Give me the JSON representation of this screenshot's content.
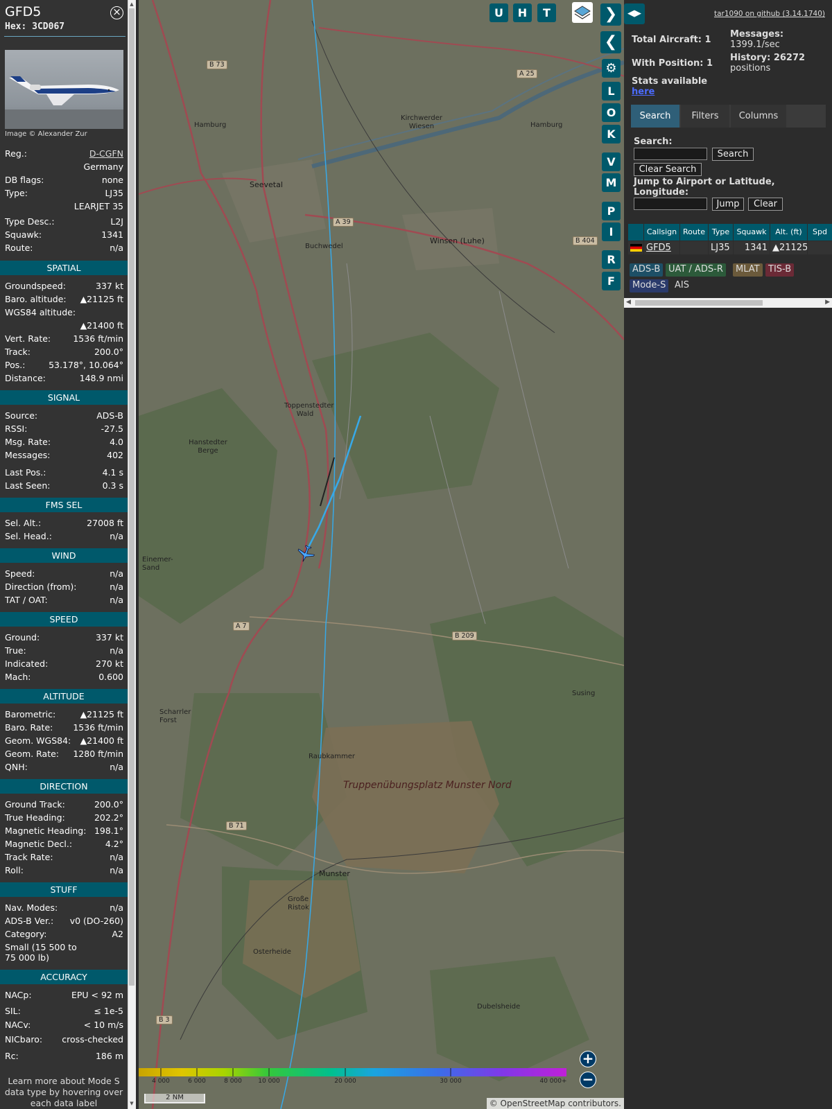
{
  "aircraft": {
    "callsign": "GFD5",
    "hex": "Hex: 3CD067",
    "photo_credit": "Image © Alexander Zur",
    "details": [
      {
        "k": "Reg.:",
        "v": "D-CGFN"
      },
      {
        "k": "",
        "v": "Germany"
      },
      {
        "k": "DB flags:",
        "v": "none"
      },
      {
        "k": "Type:",
        "v": "LJ35"
      },
      {
        "k": "",
        "v": "LEARJET 35"
      },
      {
        "k": "Type Desc.:",
        "v": "L2J"
      },
      {
        "k": "Squawk:",
        "v": "1341"
      },
      {
        "k": "Route:",
        "v": "n/a"
      }
    ],
    "sections": {
      "spatial": {
        "title": "SPATIAL",
        "rows": [
          {
            "k": "Groundspeed:",
            "v": "337 kt"
          },
          {
            "k": "Baro. altitude:",
            "v": "▲21125 ft"
          },
          {
            "k": "WGS84 altitude:",
            "v": ""
          },
          {
            "k": "",
            "v": "▲21400 ft"
          },
          {
            "k": "Vert. Rate:",
            "v": "1536 ft/min"
          },
          {
            "k": "Track:",
            "v": "200.0°"
          },
          {
            "k": "Pos.:",
            "v": "53.178°, 10.064°"
          },
          {
            "k": "Distance:",
            "v": "148.9 nmi"
          }
        ]
      },
      "signal": {
        "title": "SIGNAL",
        "rows": [
          {
            "k": "Source:",
            "v": "ADS-B"
          },
          {
            "k": "RSSI:",
            "v": "-27.5"
          },
          {
            "k": "Msg. Rate:",
            "v": "4.0"
          },
          {
            "k": "Messages:",
            "v": "402"
          },
          {
            "k": "Last Pos.:",
            "v": "4.1 s"
          },
          {
            "k": "Last Seen:",
            "v": "0.3 s"
          }
        ]
      },
      "fms": {
        "title": "FMS SEL",
        "rows": [
          {
            "k": "Sel. Alt.:",
            "v": "27008 ft"
          },
          {
            "k": "Sel. Head.:",
            "v": "n/a"
          }
        ]
      },
      "wind": {
        "title": "WIND",
        "rows": [
          {
            "k": "Speed:",
            "v": "n/a"
          },
          {
            "k": "Direction (from):",
            "v": "n/a"
          },
          {
            "k": "TAT / OAT:",
            "v": "n/a"
          }
        ]
      },
      "speed": {
        "title": "SPEED",
        "rows": [
          {
            "k": "Ground:",
            "v": "337 kt"
          },
          {
            "k": "True:",
            "v": "n/a"
          },
          {
            "k": "Indicated:",
            "v": "270 kt"
          },
          {
            "k": "Mach:",
            "v": "0.600"
          }
        ]
      },
      "altitude": {
        "title": "ALTITUDE",
        "rows": [
          {
            "k": "Barometric:",
            "v": "▲21125 ft"
          },
          {
            "k": "Baro. Rate:",
            "v": "1536 ft/min"
          },
          {
            "k": "Geom. WGS84:",
            "v": "▲21400 ft"
          },
          {
            "k": "Geom. Rate:",
            "v": "1280 ft/min"
          },
          {
            "k": "QNH:",
            "v": "n/a"
          }
        ]
      },
      "direction": {
        "title": "DIRECTION",
        "rows": [
          {
            "k": "Ground Track:",
            "v": "200.0°"
          },
          {
            "k": "True Heading:",
            "v": "202.2°"
          },
          {
            "k": "Magnetic Heading:",
            "v": "198.1°"
          },
          {
            "k": "Magnetic Decl.:",
            "v": "4.2°"
          },
          {
            "k": "Track Rate:",
            "v": "n/a"
          },
          {
            "k": "Roll:",
            "v": "n/a"
          }
        ]
      },
      "stuff": {
        "title": "STUFF",
        "rows": [
          {
            "k": "Nav. Modes:",
            "v": "n/a"
          },
          {
            "k": "ADS-B Ver.:",
            "v": "v0 (DO-260)"
          },
          {
            "k": "Category:",
            "v": "A2"
          }
        ],
        "category_desc": "Small (15 500 to 75 000 lb)"
      },
      "accuracy": {
        "title": "ACCURACY",
        "rows": [
          {
            "k": "NACp:",
            "v": "EPU < 92 m"
          },
          {
            "k": "SIL:",
            "v": "≤ 1e-5"
          },
          {
            "k": "NACv:",
            "v": "< 10 m/s"
          },
          {
            "k": "NICbaro:",
            "v": "cross-checked"
          },
          {
            "k": "Rc:",
            "v": "186 m"
          }
        ]
      }
    },
    "footer_note": "Learn more about Mode S data type by hovering over each data label"
  },
  "map": {
    "buttons_top": [
      "U",
      "H",
      "T"
    ],
    "buttons_side": [
      "L",
      "O",
      "K",
      "V",
      "M",
      "P",
      "I",
      "R",
      "F"
    ],
    "labels": {
      "seevetal": "Seevetal",
      "winsen": "Winsen (Luhe)",
      "buchwedel": "Buchwedel",
      "toppenstedt": "Toppenstedter Wald",
      "hanstedter": "Hanstedter Berge",
      "einemer": "Einemer-Sand",
      "scharrler": "Scharrler Forst",
      "raubkammer": "Raubkammer",
      "truppen": "Truppenübungsplatz Munster Nord",
      "munster": "Munster",
      "grosse_ristok": "Große Ristok",
      "osterheide": "Osterheide",
      "dubelsheide": "Dubelsheide",
      "susing": "Susing",
      "kirchwerder": "Kirchwerder Wiesen",
      "hamburg1": "Hamburg",
      "hamburg2": "Hamburg"
    },
    "shields": [
      "B 73",
      "A 25",
      "A 39",
      "B 404",
      "A 7",
      "B 209",
      "B 71",
      "B 3"
    ],
    "altitude_scale": [
      "4 000",
      "6 000",
      "8 000",
      "10 000",
      "20 000",
      "30 000",
      "40 000+"
    ],
    "scale_bar": "2 NM",
    "attribution": "© OpenStreetMap contributors."
  },
  "sidebar": {
    "github": "tar1090 on github (3.14.1740)",
    "total_aircraft": "Total Aircraft: 1",
    "with_position": "With Position: 1",
    "stats_text": "Stats available",
    "stats_link": "here",
    "messages_label": "Messages:",
    "messages_val": "1399.1/sec",
    "history_label": "History: 26272",
    "history_val": "positions",
    "tabs": [
      "Search",
      "Filters",
      "Columns"
    ],
    "search_label": "Search:",
    "search_btn": "Search",
    "clear_search_btn": "Clear Search",
    "jump_label": "Jump to Airport or Latitude, Longitude:",
    "jump_btn": "Jump",
    "clear_btn": "Clear",
    "table_headers": [
      "",
      "Callsign",
      "Route",
      "Type",
      "Squawk",
      "Alt. (ft)",
      "Spd"
    ],
    "table_row": {
      "callsign": "GFD5",
      "route": "",
      "type": "LJ35",
      "squawk": "1341",
      "alt": "▲21125",
      "spd": ""
    },
    "sources": [
      {
        "label": "ADS-B",
        "bg": "#1d4f66",
        "fg": "#ddd"
      },
      {
        "label": "UAT / ADS-R",
        "bg": "#2c5a3a",
        "fg": "#ddd"
      },
      {
        "label": "MLAT",
        "bg": "#6b5a3b",
        "fg": "#ddd"
      },
      {
        "label": "TIS-B",
        "bg": "#6b2a36",
        "fg": "#ddd"
      },
      {
        "label": "Mode-S",
        "bg": "#2a3a6b",
        "fg": "#ddd"
      },
      {
        "label": "AIS",
        "bg": "transparent",
        "fg": "#ddd"
      }
    ]
  }
}
